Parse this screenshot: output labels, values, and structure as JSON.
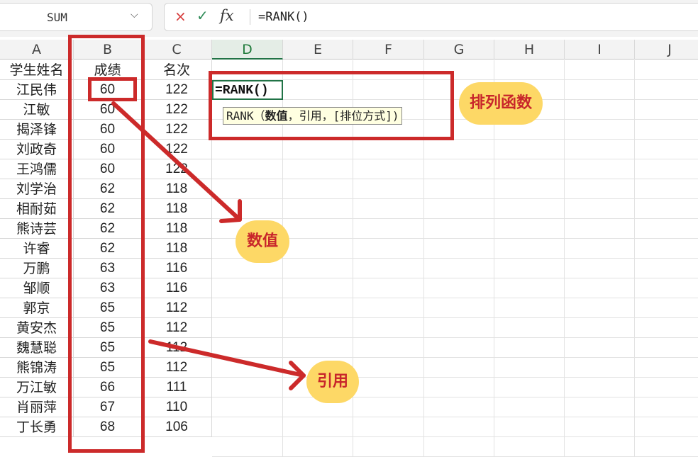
{
  "formula_bar": {
    "name_box": "SUM",
    "formula": "=RANK()",
    "cancel_icon": "×",
    "confirm_icon": "✓",
    "fx_label": "fx"
  },
  "columns": [
    "A",
    "B",
    "C",
    "D",
    "E",
    "F",
    "G",
    "H",
    "I",
    "J"
  ],
  "active_column": "D",
  "header_row": {
    "name": "学生姓名",
    "score": "成绩",
    "rank": "名次"
  },
  "rows": [
    {
      "name": "江民伟",
      "score": "60",
      "rank": "122"
    },
    {
      "name": "江敏",
      "score": "60",
      "rank": "122"
    },
    {
      "name": "揭泽锋",
      "score": "60",
      "rank": "122"
    },
    {
      "name": "刘政奇",
      "score": "60",
      "rank": "122"
    },
    {
      "name": "王鸿儒",
      "score": "60",
      "rank": "122"
    },
    {
      "name": "刘学治",
      "score": "62",
      "rank": "118"
    },
    {
      "name": "相耐茹",
      "score": "62",
      "rank": "118"
    },
    {
      "name": "熊诗芸",
      "score": "62",
      "rank": "118"
    },
    {
      "name": "许睿",
      "score": "62",
      "rank": "118"
    },
    {
      "name": "万鹏",
      "score": "63",
      "rank": "116"
    },
    {
      "name": "邹顺",
      "score": "63",
      "rank": "116"
    },
    {
      "name": "郭京",
      "score": "65",
      "rank": "112"
    },
    {
      "name": "黄安杰",
      "score": "65",
      "rank": "112"
    },
    {
      "name": "魏慧聪",
      "score": "65",
      "rank": "112"
    },
    {
      "name": "熊锦涛",
      "score": "65",
      "rank": "112"
    },
    {
      "name": "万江敏",
      "score": "66",
      "rank": "111"
    },
    {
      "name": "肖丽萍",
      "score": "67",
      "rank": "110"
    },
    {
      "name": "丁长勇",
      "score": "68",
      "rank": "106"
    }
  ],
  "active_cell_text": "=RANK()",
  "tooltip": {
    "prefix": "RANK（",
    "bold": "数值",
    "rest": "，引用，[排位方式])"
  },
  "annotations": {
    "function_label": "排列函数",
    "value_label": "数值",
    "reference_label": "引用"
  },
  "colors": {
    "annotation_red": "#cc2a2a",
    "bubble_yellow": "#fdd866",
    "bubble_text": "#c8262b",
    "excel_green": "#217346"
  }
}
